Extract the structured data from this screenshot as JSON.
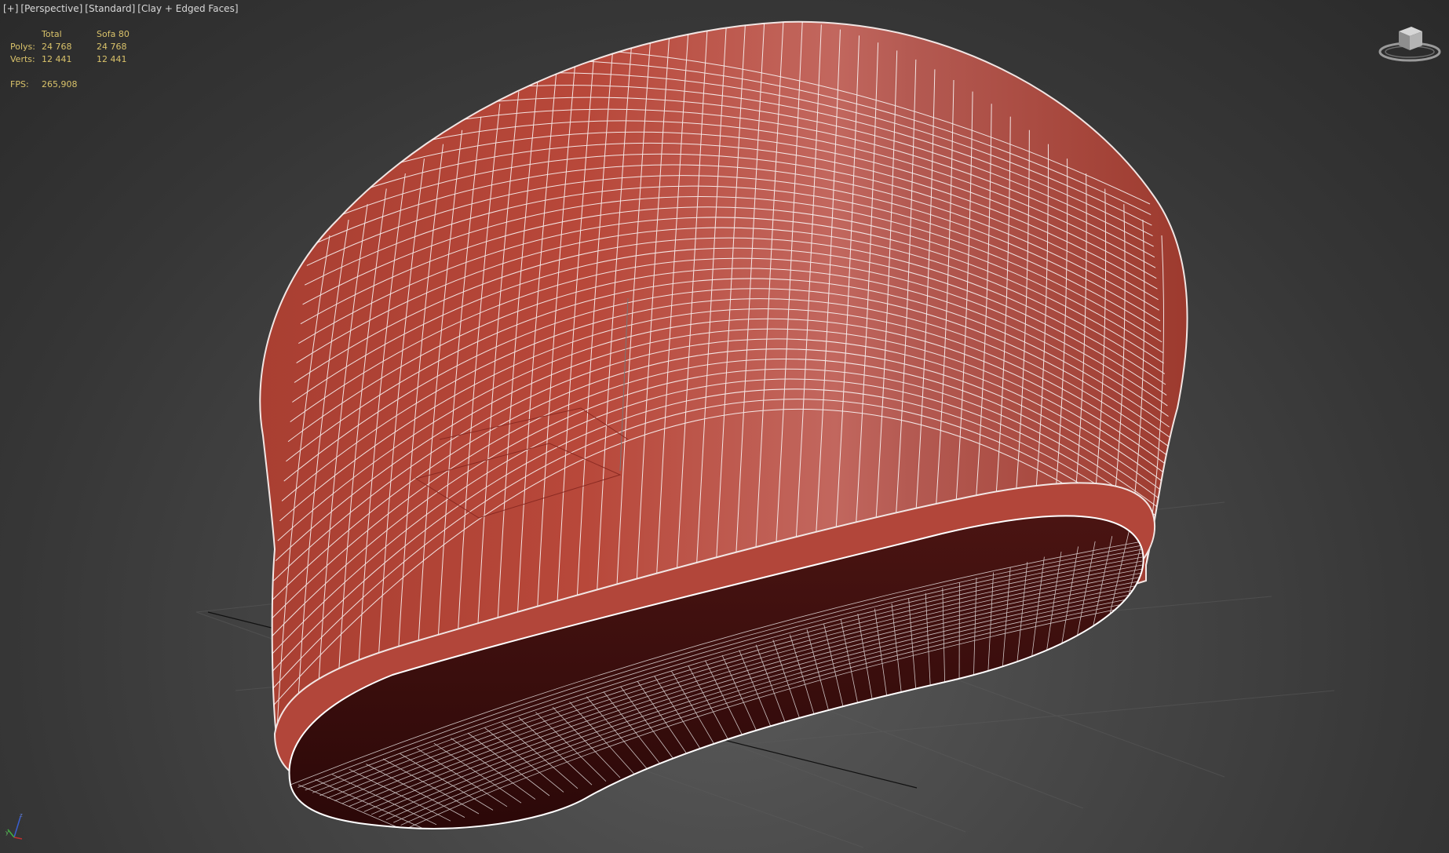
{
  "viewport_labels": {
    "plus": "[+]",
    "view": "[Perspective]",
    "shading_preset": "[Standard]",
    "style": "[Clay + Edged Faces]"
  },
  "stats": {
    "header_total": "Total",
    "header_object": "Sofa 80",
    "polys_label": "Polys:",
    "polys_total": "24 768",
    "polys_object": "24 768",
    "verts_label": "Verts:",
    "verts_total": "12 441",
    "verts_object": "12 441",
    "fps_label": "FPS:",
    "fps_value": "265,908"
  },
  "colors": {
    "stats_text": "#d9c26a",
    "menu_text": "#d9d9d9",
    "clay": "#b5473b",
    "wire": "#ffffff"
  },
  "icons": {
    "viewcube": "viewcube-icon",
    "axis": "axis-tripod-icon"
  }
}
